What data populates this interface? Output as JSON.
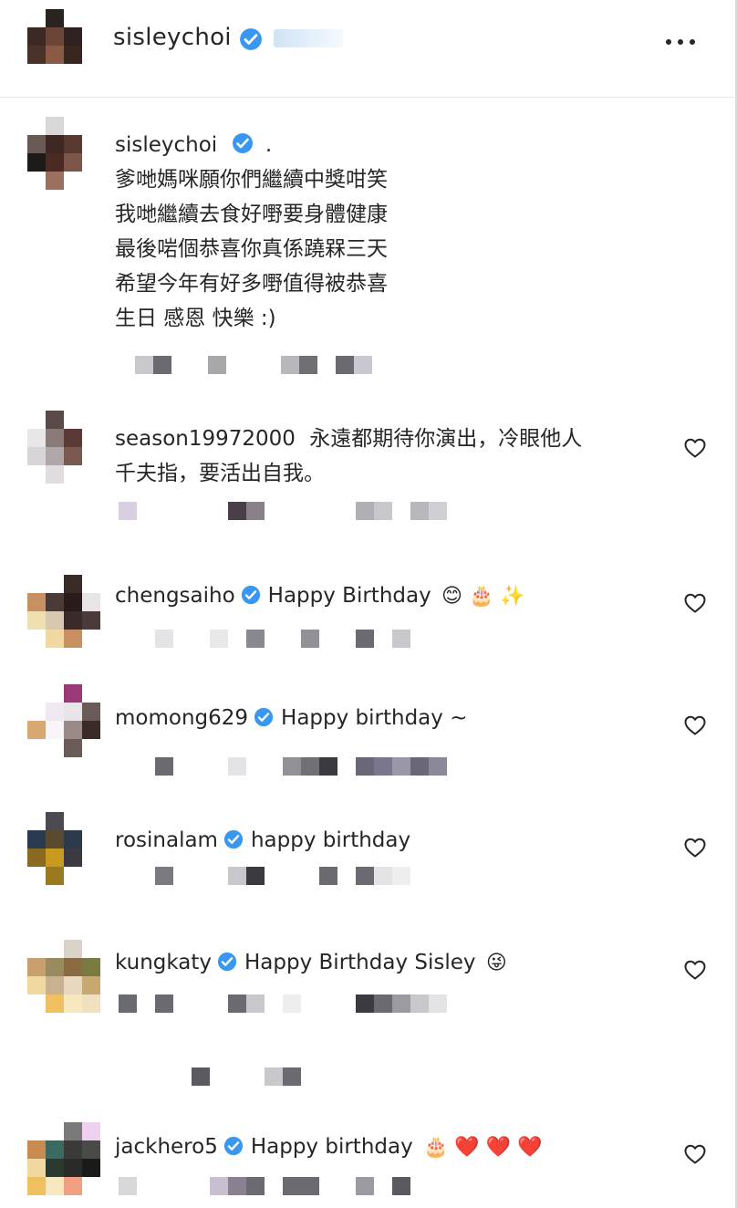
{
  "header": {
    "username": "sisleychoi",
    "more_icon": "more-horizontal-icon"
  },
  "caption": {
    "username": "sisleychoi",
    "first_line_text": ".",
    "lines": [
      "爹哋媽咪願你們繼續中獎咁笑",
      "我哋繼續去食好嘢要身體健康",
      "最後啱個恭喜你真係蹺槑三天",
      "希望今年有好多嘢值得被恭喜",
      "生日 感恩 快樂 :)"
    ]
  },
  "comments": [
    {
      "username": "season19972000",
      "text": "永遠都期待你演出，冷眼他人",
      "text2": "千夫指，要活出自我。"
    },
    {
      "username": "chengsaiho",
      "text": "Happy Birthday",
      "emoji": "😊 🎂 ✨"
    },
    {
      "username": "momong629",
      "text": "Happy birthday ~"
    },
    {
      "username": "rosinalam",
      "text": "happy birthday"
    },
    {
      "username": "kungkaty",
      "text": "Happy Birthday Sisley",
      "emoji": "😜"
    },
    {
      "username": "jackhero5",
      "text": "Happy birthday",
      "emoji": "🎂 ❤️ ❤️ ❤️"
    }
  ],
  "colors": {
    "verified_blue": "#3897f0",
    "text": "#262626",
    "divider": "#e8e8e8"
  }
}
